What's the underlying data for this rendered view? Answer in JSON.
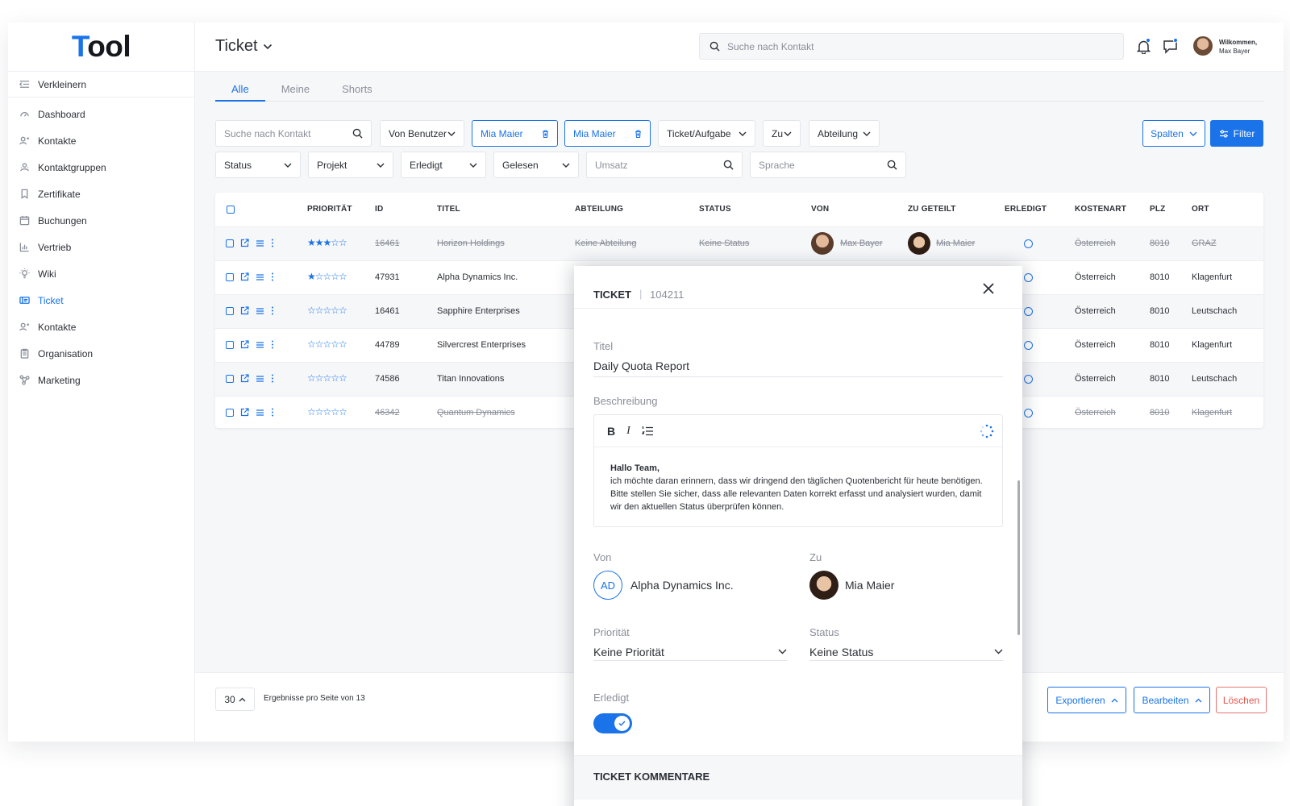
{
  "colors": {
    "accent": "#1a73e8",
    "danger": "#e5534b",
    "background": "#f6f7f9"
  },
  "logo": {
    "letter_t": "T",
    "rest": "ool"
  },
  "sidebar": {
    "collapse_label": "Verkleinern",
    "items": [
      {
        "label": "Dashboard",
        "icon": "dashboard-icon"
      },
      {
        "label": "Kontakte",
        "icon": "contacts-icon"
      },
      {
        "label": "Kontaktgruppen",
        "icon": "contact-groups-icon"
      },
      {
        "label": "Zertifikate",
        "icon": "bookmark-icon"
      },
      {
        "label": "Buchungen",
        "icon": "calendar-icon"
      },
      {
        "label": "Vertrieb",
        "icon": "bar-chart-icon"
      },
      {
        "label": "Wiki",
        "icon": "lightbulb-icon"
      },
      {
        "label": "Ticket",
        "icon": "ticket-icon",
        "active": true
      },
      {
        "label": "Kontakte",
        "icon": "contacts-icon"
      },
      {
        "label": "Organisation",
        "icon": "clipboard-icon"
      },
      {
        "label": "Marketing",
        "icon": "network-icon"
      }
    ]
  },
  "header": {
    "title": "Ticket",
    "search_placeholder": "Suche nach Kontakt",
    "welcome": "Wilkommen,",
    "user_name": "Max Bayer"
  },
  "tabs": [
    "Alle",
    "Meine",
    "Shorts"
  ],
  "filters": {
    "search_placeholder": "Suche nach Kontakt",
    "von_benutzer": "Von Benutzer",
    "chip_1": "Mia Maier",
    "chip_2": "Mia Maier",
    "ticket_aufgabe": "Ticket/Aufgabe",
    "zu": "Zu",
    "abteilung": "Abteilung",
    "status": "Status",
    "projekt": "Projekt",
    "erledigt": "Erledigt",
    "gelesen": "Gelesen",
    "umsatz_placeholder": "Umsatz",
    "sprache_placeholder": "Sprache",
    "spalten": "Spalten",
    "filter": "Filter"
  },
  "table": {
    "headers": [
      "PRIORITÄT",
      "ID",
      "TITEL",
      "ABTEILUNG",
      "STATUS",
      "VON",
      "ZU GETEILT",
      "ERLEDIGT",
      "KOSTENART",
      "PLZ",
      "ORT"
    ],
    "rows": [
      {
        "stars": "★★★☆☆",
        "priority": 3,
        "id": "16461",
        "title": "Horizon Holdings",
        "abteilung": "Keine Abteilung",
        "status": "Keine Status",
        "von": "Max Bayer",
        "zu": "Mia Maier",
        "kostenart": "Österreich",
        "plz": "8010",
        "ort": "GRAZ",
        "struck": true
      },
      {
        "stars": "★☆☆☆☆",
        "priority": 1,
        "id": "47931",
        "title": "Alpha Dynamics Inc.",
        "kostenart": "Österreich",
        "plz": "8010",
        "ort": "Klagenfurt",
        "struck": false
      },
      {
        "stars": "☆☆☆☆☆",
        "priority": 0,
        "id": "16461",
        "title": "Sapphire Enterprises",
        "kostenart": "Österreich",
        "plz": "8010",
        "ort": "Leutschach",
        "struck": false
      },
      {
        "stars": "☆☆☆☆☆",
        "priority": 0,
        "id": "44789",
        "title": "Silvercrest Enterprises",
        "kostenart": "Österreich",
        "plz": "8010",
        "ort": "Klagenfurt",
        "struck": false
      },
      {
        "stars": "☆☆☆☆☆",
        "priority": 0,
        "id": "74586",
        "title": "Titan Innovations",
        "kostenart": "Österreich",
        "plz": "8010",
        "ort": "Leutschach",
        "struck": false
      },
      {
        "stars": "☆☆☆☆☆",
        "priority": 0,
        "id": "46342",
        "title": "Quantum Dynamics",
        "kostenart": "Österreich",
        "plz": "8010",
        "ort": "Klagenfurt",
        "struck": true
      }
    ]
  },
  "pagination": {
    "per_page": "30",
    "info": "Ergebnisse pro Seite von 13"
  },
  "actions": {
    "export": "Exportieren",
    "edit": "Bearbeiten",
    "delete": "Löschen"
  },
  "modal": {
    "title": "TICKET",
    "separator": "|",
    "ticket_id": "104211",
    "titel_label": "Titel",
    "titel_value": "Daily Quota Report",
    "beschreibung_label": "Beschreibung",
    "bold": "B",
    "italic": "I",
    "greeting": "Hallo Team,",
    "body": "ich möchte daran erinnern, dass wir dringend den täglichen Quotenbericht für heute benötigen. Bitte stellen Sie sicher, dass alle relevanten Daten korrekt erfasst und analysiert wurden, damit wir den aktuellen Status überprüfen können.",
    "von_label": "Von",
    "von_initials": "AD",
    "von_name": "Alpha Dynamics Inc.",
    "zu_label": "Zu",
    "zu_name": "Mia Maier",
    "prioritaet_label": "Priorität",
    "prioritaet_value": "Keine Priorität",
    "status_label": "Status",
    "status_value": "Keine Status",
    "erledigt_label": "Erledigt",
    "erledigt_on": true,
    "comments_title": "TICKET KOMMENTARE"
  }
}
